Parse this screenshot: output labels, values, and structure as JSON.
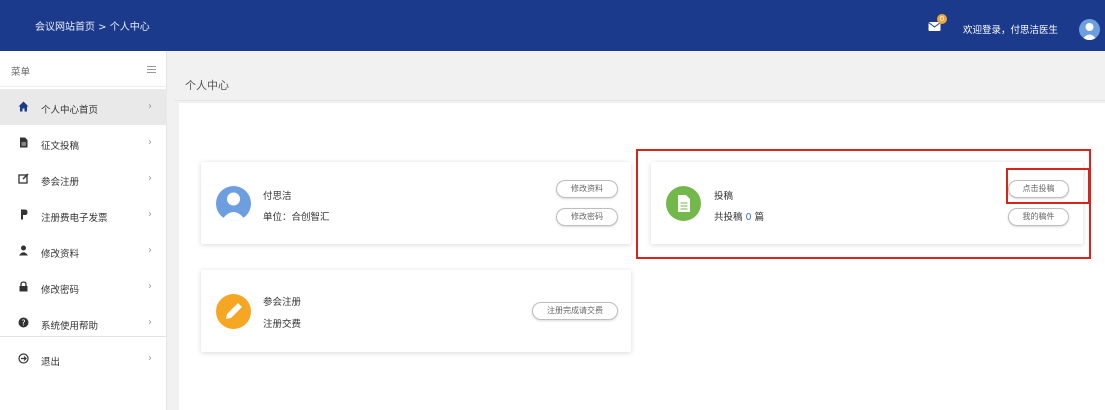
{
  "topbar": {
    "breadcrumb": "会议网站首页 > 个人中心",
    "mail_badge": "0",
    "welcome": "欢迎登录，付思洁医生"
  },
  "sidebar": {
    "title": "菜单",
    "items": [
      {
        "label": "个人中心首页",
        "icon": "home-icon"
      },
      {
        "label": "征文投稿",
        "icon": "document-icon"
      },
      {
        "label": "参会注册",
        "icon": "edit-icon"
      },
      {
        "label": "注册费电子发票",
        "icon": "invoice-icon"
      },
      {
        "label": "修改资料",
        "icon": "user-icon"
      },
      {
        "label": "修改密码",
        "icon": "lock-icon"
      },
      {
        "label": "系统使用帮助",
        "icon": "help-icon"
      },
      {
        "label": "退出",
        "icon": "logout-icon"
      }
    ]
  },
  "content": {
    "title": "个人中心"
  },
  "profile_card": {
    "name": "付思洁",
    "unit": "单位：合创智汇",
    "edit_profile": "修改资料",
    "change_password": "修改密码"
  },
  "submission_card": {
    "title": "投稿",
    "count_prefix": "共投稿 ",
    "count": "0",
    "count_suffix": " 篇",
    "submit_button": "点击投稿",
    "my_submissions_button": "我的稿件"
  },
  "registration_card": {
    "title": "参会注册",
    "subtitle": "注册交费",
    "button": "注册完成请交费"
  },
  "colors": {
    "topbar": "#1b3a8c",
    "highlight": "#d9241c",
    "profile_icon": "#6d9ee0",
    "submission_icon": "#73b84a",
    "registration_icon": "#f5a623"
  }
}
